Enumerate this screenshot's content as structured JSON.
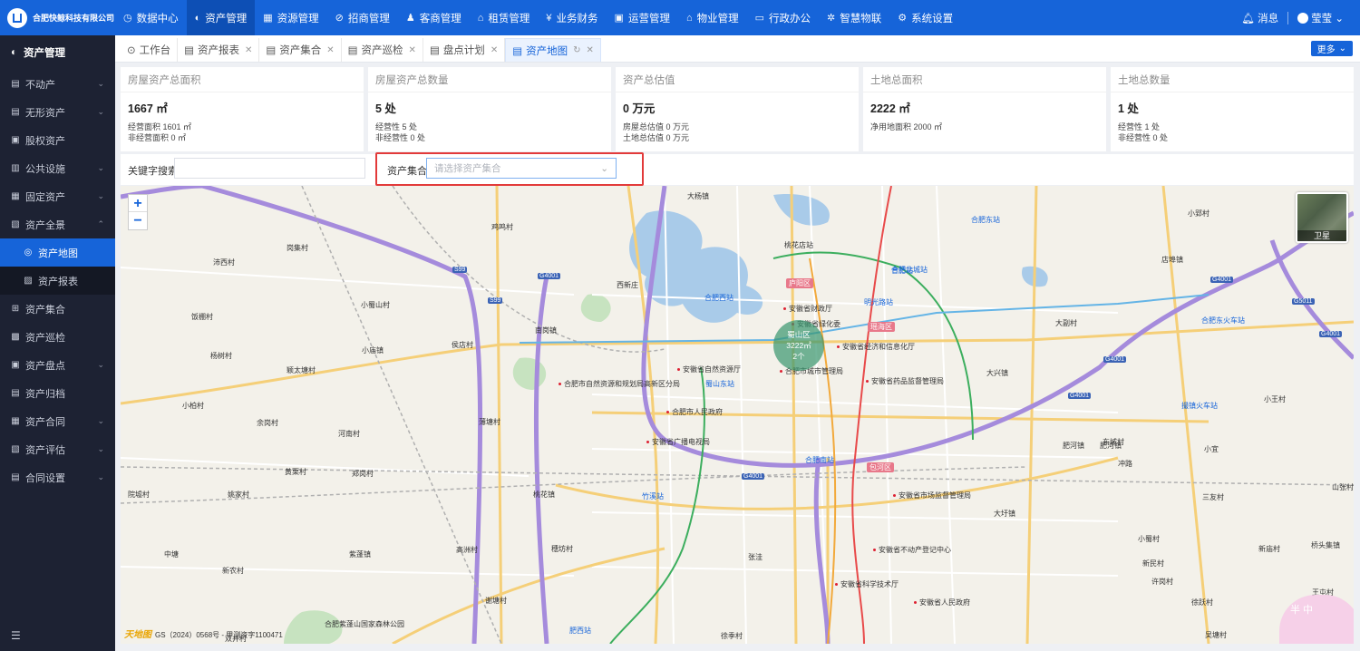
{
  "app": {
    "company": "合肥快鲸科技有限公司"
  },
  "topnav": [
    {
      "icon": "◷",
      "label": "数据中心"
    },
    {
      "icon": "◐",
      "label": "资产管理",
      "active": true
    },
    {
      "icon": "▦",
      "label": "资源管理"
    },
    {
      "icon": "⊘",
      "label": "招商管理"
    },
    {
      "icon": "♟",
      "label": "客商管理"
    },
    {
      "icon": "⌂",
      "label": "租赁管理"
    },
    {
      "icon": "¥",
      "label": "业务财务"
    },
    {
      "icon": "▣",
      "label": "运营管理"
    },
    {
      "icon": "⌂",
      "label": "物业管理"
    },
    {
      "icon": "▭",
      "label": "行政办公"
    },
    {
      "icon": "✲",
      "label": "智慧物联"
    },
    {
      "icon": "⚙",
      "label": "系统设置"
    }
  ],
  "topright": {
    "message": "消息",
    "user": "莹莹"
  },
  "sidebar": {
    "header": "资产管理",
    "items": [
      {
        "label": "不动产",
        "arrow": "⌄"
      },
      {
        "label": "无形资产",
        "arrow": "⌄"
      },
      {
        "label": "股权资产",
        "arrow": ""
      },
      {
        "label": "公共设施",
        "arrow": "⌄"
      },
      {
        "label": "固定资产",
        "arrow": "⌄"
      },
      {
        "label": "资产全景",
        "arrow": "⌃"
      },
      {
        "label": "资产地图",
        "sub": true,
        "active": true
      },
      {
        "label": "资产报表",
        "sub": true
      },
      {
        "label": "资产集合",
        "arrow": ""
      },
      {
        "label": "资产巡检",
        "arrow": ""
      },
      {
        "label": "资产盘点",
        "arrow": "⌄"
      },
      {
        "label": "资产归档",
        "arrow": ""
      },
      {
        "label": "资产合同",
        "arrow": "⌄"
      },
      {
        "label": "资产评估",
        "arrow": "⌄"
      },
      {
        "label": "合同设置",
        "arrow": "⌄"
      }
    ]
  },
  "tabs": [
    {
      "label": "工作台",
      "closable": false
    },
    {
      "label": "资产报表",
      "closable": true
    },
    {
      "label": "资产集合",
      "closable": true
    },
    {
      "label": "资产巡检",
      "closable": true
    },
    {
      "label": "盘点计划",
      "closable": true
    },
    {
      "label": "资产地图",
      "closable": true,
      "active": true
    }
  ],
  "more_label": "更多",
  "cards": [
    {
      "title": "房屋资产总面积",
      "value": "1667 ㎡",
      "lines": [
        "经营面积 1601 ㎡",
        "非经营面积 0 ㎡"
      ]
    },
    {
      "title": "房屋资产总数量",
      "value": "5 处",
      "lines": [
        "经营性 5 处",
        "非经营性 0 处"
      ]
    },
    {
      "title": "资产总估值",
      "value": "0 万元",
      "lines": [
        "房屋总估值 0 万元",
        "土地总估值 0 万元"
      ]
    },
    {
      "title": "土地总面积",
      "value": "2222 ㎡",
      "lines": [
        "净用地面积 2000 ㎡",
        ""
      ]
    },
    {
      "title": "土地总数量",
      "value": "1 处",
      "lines": [
        "经营性 1 处",
        "非经营性 0 处"
      ]
    }
  ],
  "filters": {
    "keyword_label": "关键字搜索",
    "keyword_value": "",
    "collection_label": "资产集合",
    "collection_placeholder": "请选择资产集合"
  },
  "map": {
    "cluster": {
      "district": "蜀山区",
      "area": "3222㎡",
      "count": "2个"
    },
    "satellite_label": "卫星",
    "zoom_in": "+",
    "zoom_out": "−",
    "copyright": "GS（2024）0568号 - 甲测资字1100471",
    "copyright_logo": "天地图",
    "mascot_text": "半 中",
    "labels": {
      "districts": [
        "庐阳区",
        "瑶海区",
        "包河区"
      ],
      "highways": [
        "S99",
        "G4001",
        "S99",
        "G4001",
        "G4001",
        "G4001",
        "G4001",
        "G5011",
        "G4001"
      ],
      "stations": [
        "合肥北城站",
        "合肥东站",
        "合肥站",
        "明光路站",
        "合肥西站",
        "蜀山东站",
        "合肥东火车站",
        "撮镇火车站",
        "竹溪站",
        "合肥南站",
        "肥西站"
      ],
      "places": [
        "大杨镇",
        "桃花店站",
        "鸡鸣村",
        "岗集村",
        "沛西村",
        "小蜀山村",
        "饭棚村",
        "杨树村",
        "西新庄",
        "南岗镇",
        "侯店村",
        "小庙镇",
        "颖太塘村",
        "小柏村",
        "余岗村",
        "河南村",
        "黄栗村",
        "郑岗村",
        "桃花镇",
        "薄塘村",
        "姚家村",
        "院墟村",
        "中塘",
        "新农村",
        "紫蓬镇",
        "高洲村",
        "穗坊村",
        "谢塘村",
        "合肥紫蓬山国家森林公园",
        "双井村",
        "张洼",
        "徐季村",
        "店埠镇",
        "大副村",
        "大兴镇",
        "东城村",
        "冲路",
        "三友村",
        "大圩镇",
        "小蜀村",
        "新民村",
        "许岗村",
        "徐跃村",
        "小王村",
        "小宜",
        "肥河镇",
        "新庙村",
        "山张村",
        "桥头集镇",
        "小郢村",
        "吴塘村",
        "王屯村",
        "肥河镇"
      ],
      "pois": [
        "安徽省财政厅",
        "安徽省绿化委",
        "安徽省经济和信息化厅",
        "安徽省自然资源厅",
        "合肥市城市管理局",
        "合肥市自然资源和规划局高新区分局",
        "合肥市人民政府",
        "安徽省药品监督管理局",
        "安徽省广播电视局",
        "安徽省市场监督管理局",
        "安徽省不动产登记中心",
        "安徽省科学技术厅",
        "安徽省人民政府"
      ]
    }
  }
}
